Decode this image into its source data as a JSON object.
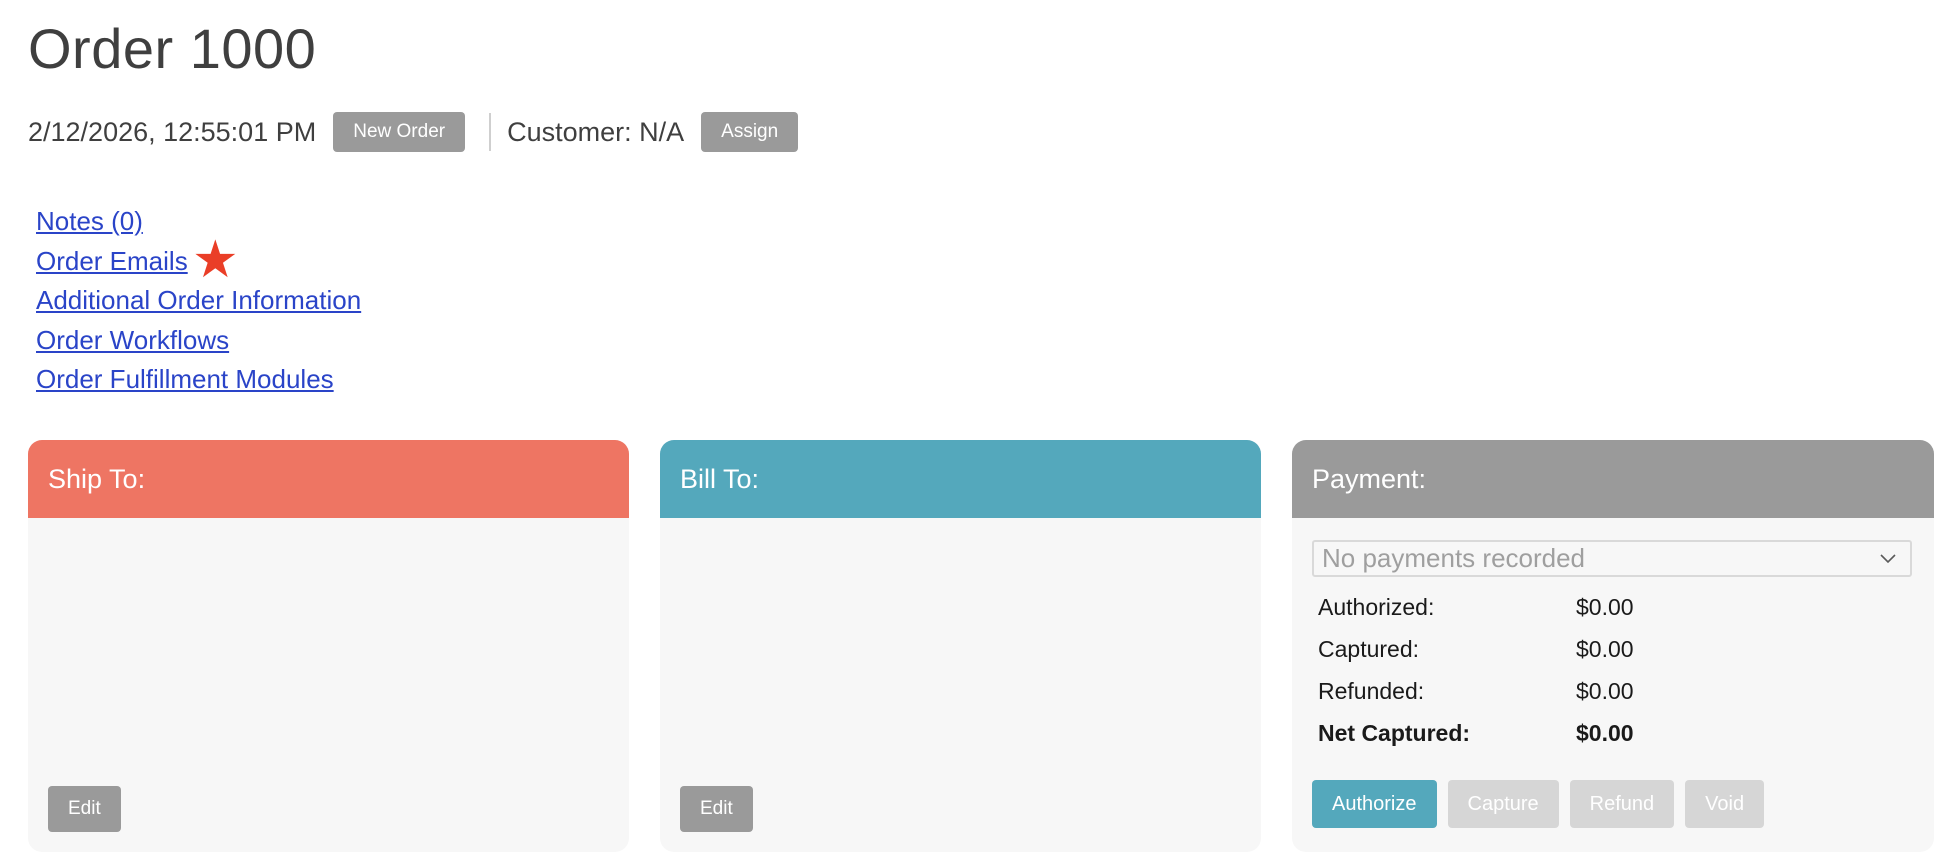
{
  "order": {
    "title": "Order 1000",
    "datetime": "2/12/2026, 12:55:01 PM",
    "new_order_label": "New Order",
    "customer_label": "Customer: N/A",
    "assign_label": "Assign"
  },
  "links": {
    "notes": "Notes (0)",
    "emails": "Order Emails",
    "additional_info": "Additional Order Information",
    "workflows": "Order Workflows",
    "fulfillment": "Order Fulfillment Modules"
  },
  "ship_to": {
    "header": "Ship To:",
    "edit_label": "Edit"
  },
  "bill_to": {
    "header": "Bill To:",
    "edit_label": "Edit"
  },
  "payment": {
    "header": "Payment:",
    "select_value": "No payments recorded",
    "rows": {
      "authorized": {
        "label": "Authorized:",
        "value": "$0.00"
      },
      "captured": {
        "label": "Captured:",
        "value": "$0.00"
      },
      "refunded": {
        "label": "Refunded:",
        "value": "$0.00"
      },
      "net_captured": {
        "label": "Net Captured:",
        "value": "$0.00"
      }
    },
    "actions": {
      "authorize": "Authorize",
      "capture": "Capture",
      "refund": "Refund",
      "void": "Void"
    }
  },
  "colors": {
    "ship_header": "#ee7563",
    "bill_header": "#54a8bc",
    "payment_header": "#9a9a9a",
    "link": "#2a44c8",
    "star": "#ea3e27"
  },
  "icons": {
    "star": "star-icon",
    "dropdown": "chevron-down-icon"
  }
}
